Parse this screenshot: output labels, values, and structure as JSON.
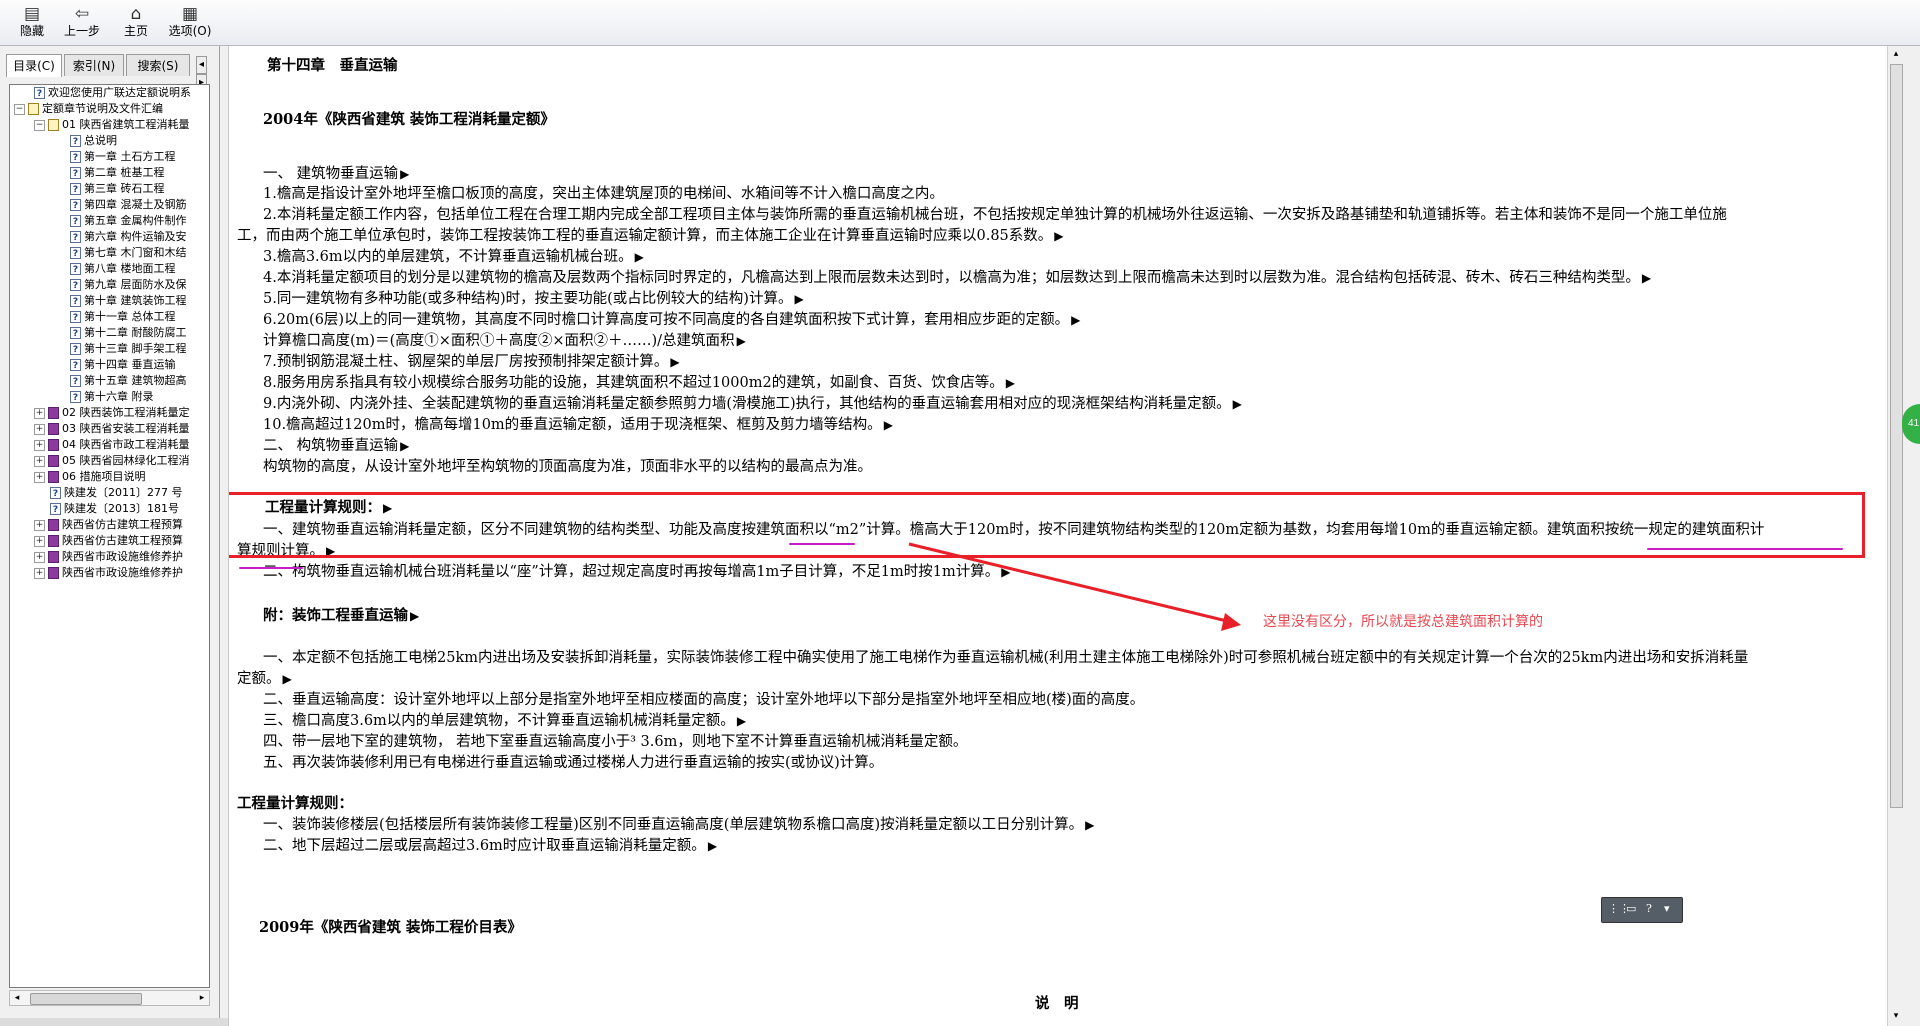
{
  "toolbar": {
    "buttons": [
      {
        "label": "隐藏",
        "icon": "hide-icon"
      },
      {
        "label": "上一步",
        "icon": "back-icon"
      },
      {
        "label": "主页",
        "icon": "home-icon"
      },
      {
        "label": "选项(O)",
        "icon": "options-icon"
      }
    ]
  },
  "nav_tabs": [
    "目录(C)",
    "索引(N)",
    "搜索(S)"
  ],
  "tree": [
    "欢迎您使用广联达定额说明系",
    "定额章节说明及文件汇编",
    "01 陕西省建筑工程消耗量",
    "总说明",
    "第一章 土石方工程",
    "第二章 桩基工程",
    "第三章 砖石工程",
    "第四章 混凝土及钢筋",
    "第五章 金属构件制作",
    "第六章 构件运输及安",
    "第七章 木门窗和木结",
    "第八章 楼地面工程",
    "第九章 层面防水及保",
    "第十章 建筑装饰工程",
    "第十一章 总体工程",
    "第十二章 耐酸防腐工",
    "第十三章 脚手架工程",
    "第十四章 垂直运输",
    "第十五章 建筑物超高",
    "第十六章 附录",
    "02 陕西装饰工程消耗量定",
    "03 陕西省安装工程消耗量",
    "04 陕西省市政工程消耗量",
    "05 陕西省园林绿化工程消",
    "06 措施项目说明",
    "陕建发〔2011〕277 号",
    "陕建发〔2013〕181号",
    "陕西省仿古建筑工程预算",
    "陕西省仿古建筑工程预算",
    "陕西省市政设施维修养护",
    "陕西省市政设施维修养护"
  ],
  "content": {
    "chapter_title": "第十四章　垂直运输",
    "quota_title": "2004年《陕西省建筑 装饰工程消耗量定额》",
    "s1_heading": "一、 建筑物垂直运输",
    "s1_1": "1.檐高是指设计室外地坪至檐口板顶的高度，突出主体建筑屋顶的电梯间、水箱间等不计入檐口高度之内。",
    "s1_2a": "2.本消耗量定额工作内容，包括单位工程在合理工期内完成全部工程项目主体与装饰所需的垂直运输机械台班，不包括按规定单独计算的机械场外往返运输、一次安拆及路基铺垫和轨道铺拆等。若主体和装饰不是同一个施工单位施",
    "s1_2b": "工，而由两个施工单位承包时，装饰工程按装饰工程的垂直运输定额计算，而主体施工企业在计算垂直运输时应乘以0.85系数。",
    "s1_3": "3.檐高3.6m以内的单层建筑，不计算垂直运输机械台班。",
    "s1_4": "4.本消耗量定额项目的划分是以建筑物的檐高及层数两个指标同时界定的，凡檐高达到上限而层数未达到时，以檐高为准；如层数达到上限而檐高未达到时以层数为准。混合结构包括砖混、砖木、砖石三种结构类型。",
    "s1_5": "5.同一建筑物有多种功能(或多种结构)时，按主要功能(或占比例较大的结构)计算。",
    "s1_6": "6.20m(6层)以上的同一建筑物，其高度不同时檐口计算高度可按不同高度的各自建筑面积按下式计算，套用相应步距的定额。",
    "s1_formula": "计算檐口高度(m)＝(高度①×面积①＋高度②×面积②＋……)/总建筑面积",
    "s1_7": "7.预制钢筋混凝土柱、钢屋架的单层厂房按预制排架定额计算。",
    "s1_8": "8.服务用房系指具有较小规模综合服务功能的设施，其建筑面积不超过1000m2的建筑，如副食、百货、饮食店等。",
    "s1_9": "9.内浇外砌、内浇外挂、全装配建筑物的垂直运输消耗量定额参照剪力墙(滑模施工)执行，其他结构的垂直运输套用相对应的现浇框架结构消耗量定额。",
    "s1_10": "10.檐高超过120m时，檐高每增10m的垂直运输定额，适用于现浇框架、框剪及剪力墙等结构。",
    "s2_heading": "二、 构筑物垂直运输",
    "s2_text": "构筑物的高度，从设计室外地坪至构筑物的顶面高度为准，顶面非水平的以结构的最高点为准。",
    "rules_heading": "工程量计算规则：",
    "rule1a": "一、建筑物垂直运输消耗量定额，区分不同建筑物的结构类型、功能及高度按建筑面积以“m2”计算。檐高大于120m时，按不同建筑物结构类型的120m定额为基数，均套用每增10m的垂直运输定额。建筑面积按统一规定的建筑面积计",
    "rule1b": "算规则计算。",
    "rule2": "二、构筑物垂直运输机械台班消耗量以“座”计算，超过规定高度时再按每增高1m子目计算，不足1m时按1m计算。",
    "annotation": "这里没有区分，所以就是按总建筑面积计算的",
    "appendix_heading": "附：装饰工程垂直运输",
    "app1a": "一、本定额不包括施工电梯25km内进出场及安装拆卸消耗量，实际装饰装修工程中确实使用了施工电梯作为垂直运输机械(利用土建主体施工电梯除外)时可参照机械台班定额中的有关规定计算一个台次的25km内进出场和安拆消耗量",
    "app1b": "定额。",
    "app2": "二、垂直运输高度：设计室外地坪以上部分是指室外地坪至相应楼面的高度；设计室外地坪以下部分是指室外地坪至相应地(楼)面的高度。",
    "app3": "三、檐口高度3.6m以内的单层建筑物，不计算垂直运输机械消耗量定额。",
    "app4": "四、带一层地下室的建筑物， 若地下室垂直运输高度小于³ 3.6m，则地下室不计算垂直运输机械消耗量定额。",
    "app5": "五、再次装饰装修利用已有电梯进行垂直运输或通过楼梯人力进行垂直运输的按实(或协议)计算。",
    "rules2_heading": "工程量计算规则：",
    "r2_1": "一、装饰装修楼层(包括楼层所有装饰装修工程量)区别不同垂直运输高度(单层建筑物系檐口高度)按消耗量定额以工日分别计算。",
    "r2_2": "二、地下层超过二层或层高超过3.6m时应计取垂直运输消耗量定额。",
    "price_title": "2009年《陕西省建筑 装饰工程价目表》",
    "explain": "说　明"
  },
  "badge": "41",
  "colors": {
    "highlight_box": "#e8202a",
    "underline": "#c81ec8",
    "annotation": "#e84850"
  }
}
